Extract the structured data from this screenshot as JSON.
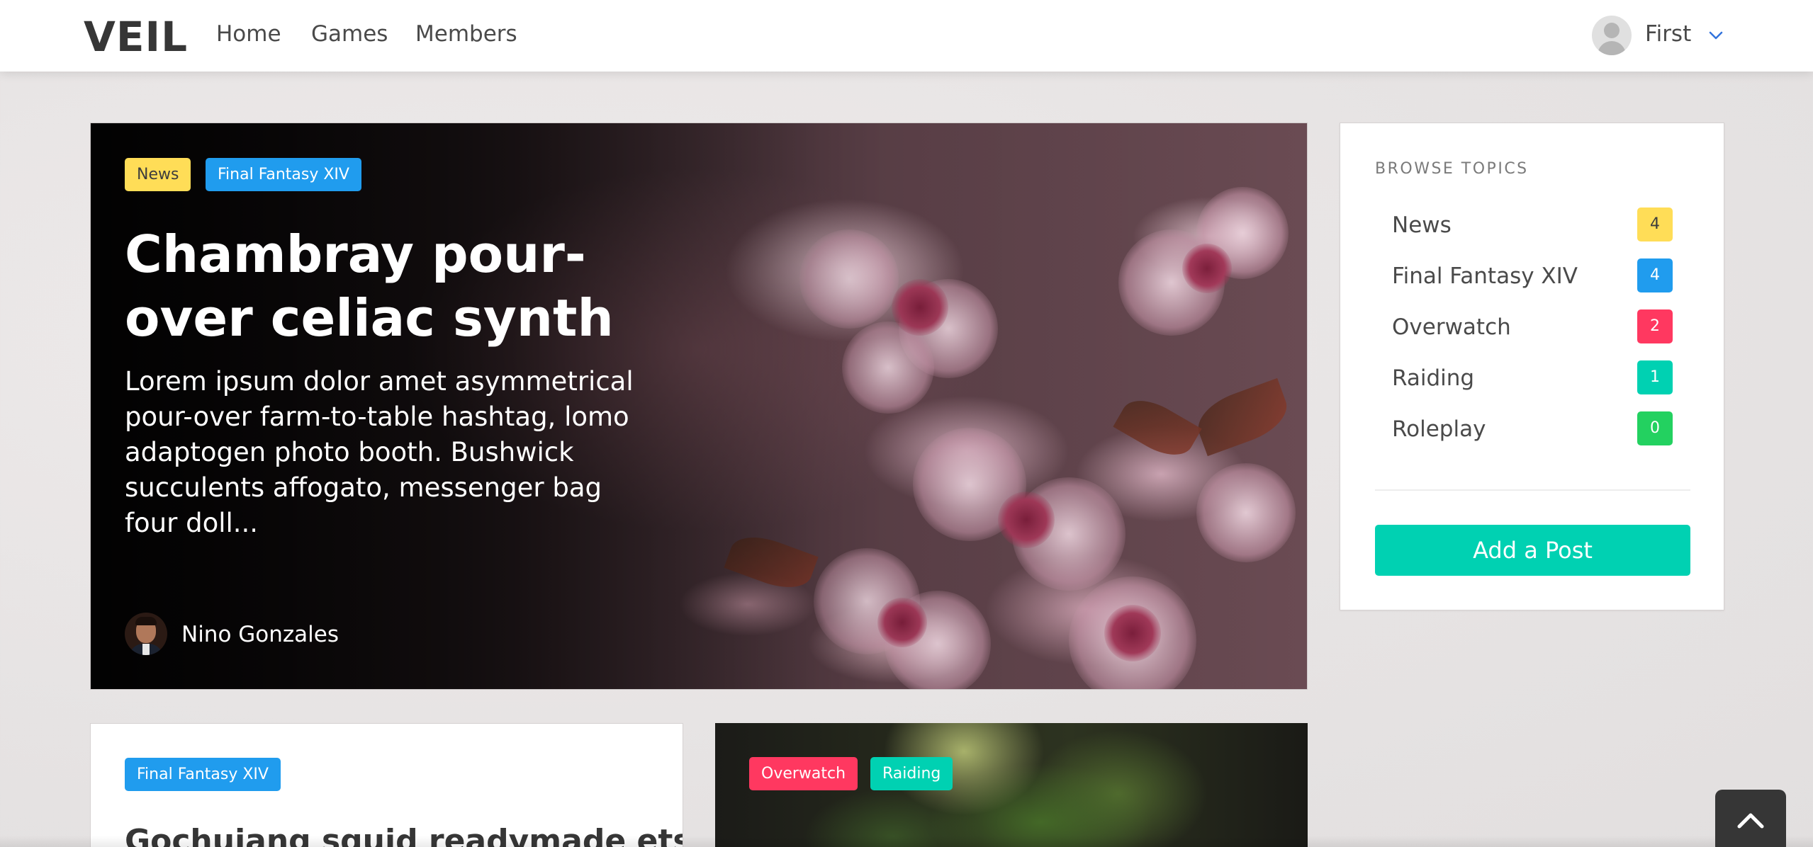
{
  "navbar": {
    "logo": "VEIL",
    "links": [
      "Home",
      "Games",
      "Members"
    ],
    "user_name": "First"
  },
  "hero": {
    "tags": [
      "News",
      "Final Fantasy XIV"
    ],
    "title": "Chambray pour-over celiac synth",
    "excerpt": "Lorem ipsum dolor amet asymmetrical pour-over farm-to-table hashtag, lomo adaptogen photo booth. Bushwick succulents affogato, messenger bag four doll...",
    "author": "Nino Gonzales"
  },
  "sidebar": {
    "heading": "BROWSE TOPICS",
    "topics": [
      {
        "label": "News",
        "count": "4",
        "color": "#ffdd57"
      },
      {
        "label": "Final Fantasy XIV",
        "count": "4",
        "color": "#209cee"
      },
      {
        "label": "Overwatch",
        "count": "2",
        "color": "#ff3860"
      },
      {
        "label": "Raiding",
        "count": "1",
        "color": "#00d1b2"
      },
      {
        "label": "Roleplay",
        "count": "0",
        "color": "#23d160"
      }
    ],
    "add_post_label": "Add a Post"
  },
  "cards": [
    {
      "tags": [
        "Final Fantasy XIV"
      ],
      "title": "Gochujang squid readymade etsy"
    },
    {
      "tags": [
        "Overwatch",
        "Raiding"
      ]
    }
  ],
  "colors": {
    "primary": "#00d1b2",
    "info": "#209cee",
    "warning": "#ffdd57",
    "danger": "#ff3860",
    "success": "#23d160",
    "chevron": "#3273dc"
  },
  "icons": {
    "user_menu": "chevron-down-icon",
    "back_to_top": "chevron-up-icon"
  }
}
